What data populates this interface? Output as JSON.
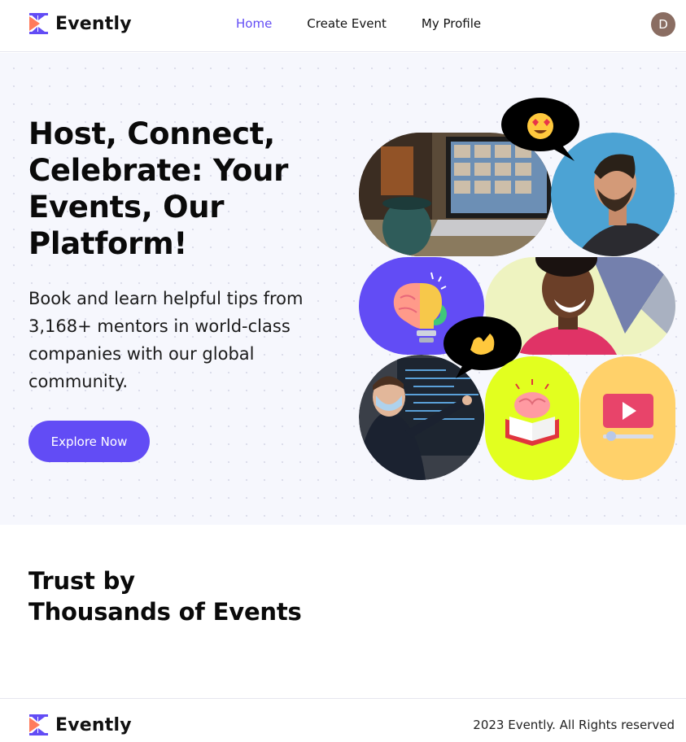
{
  "brand": {
    "name": "Evently",
    "accent": "#624CF5",
    "logo_icon": "evently-logo-icon"
  },
  "nav": {
    "items": [
      {
        "label": "Home",
        "active": true
      },
      {
        "label": "Create Event",
        "active": false
      },
      {
        "label": "My Profile",
        "active": false
      }
    ]
  },
  "user": {
    "avatar_initial": "D",
    "avatar_color": "#8a6d62"
  },
  "hero": {
    "title": "Host, Connect, Celebrate: Your Events, Our Platform!",
    "subtitle": "Book and learn helpful tips from 3,168+ mentors in world-class companies with our global community.",
    "cta_label": "Explore Now"
  },
  "collage": {
    "tiles": [
      {
        "name": "laptop-video-call-photo",
        "color": "#4a3a2c"
      },
      {
        "name": "smiling-man-photo",
        "color": "#3c9bd0"
      },
      {
        "name": "brain-lightbulb-icon",
        "color": "#624CF5"
      },
      {
        "name": "laughing-woman-photo",
        "color": "#eef3c0"
      },
      {
        "name": "presenter-screen-photo",
        "color": "#2a3340"
      },
      {
        "name": "brain-book-icon",
        "color": "#e2ff1f"
      },
      {
        "name": "video-play-icon",
        "color": "#ffd16a"
      }
    ],
    "bubbles": [
      "heart-eyes-emoji-icon",
      "waving-hand-emoji-icon"
    ]
  },
  "trust": {
    "line1": "Trust by",
    "line2": "Thousands of Events"
  },
  "footer": {
    "brand": "Evently",
    "copyright": "2023 Evently. All Rights reserved"
  }
}
